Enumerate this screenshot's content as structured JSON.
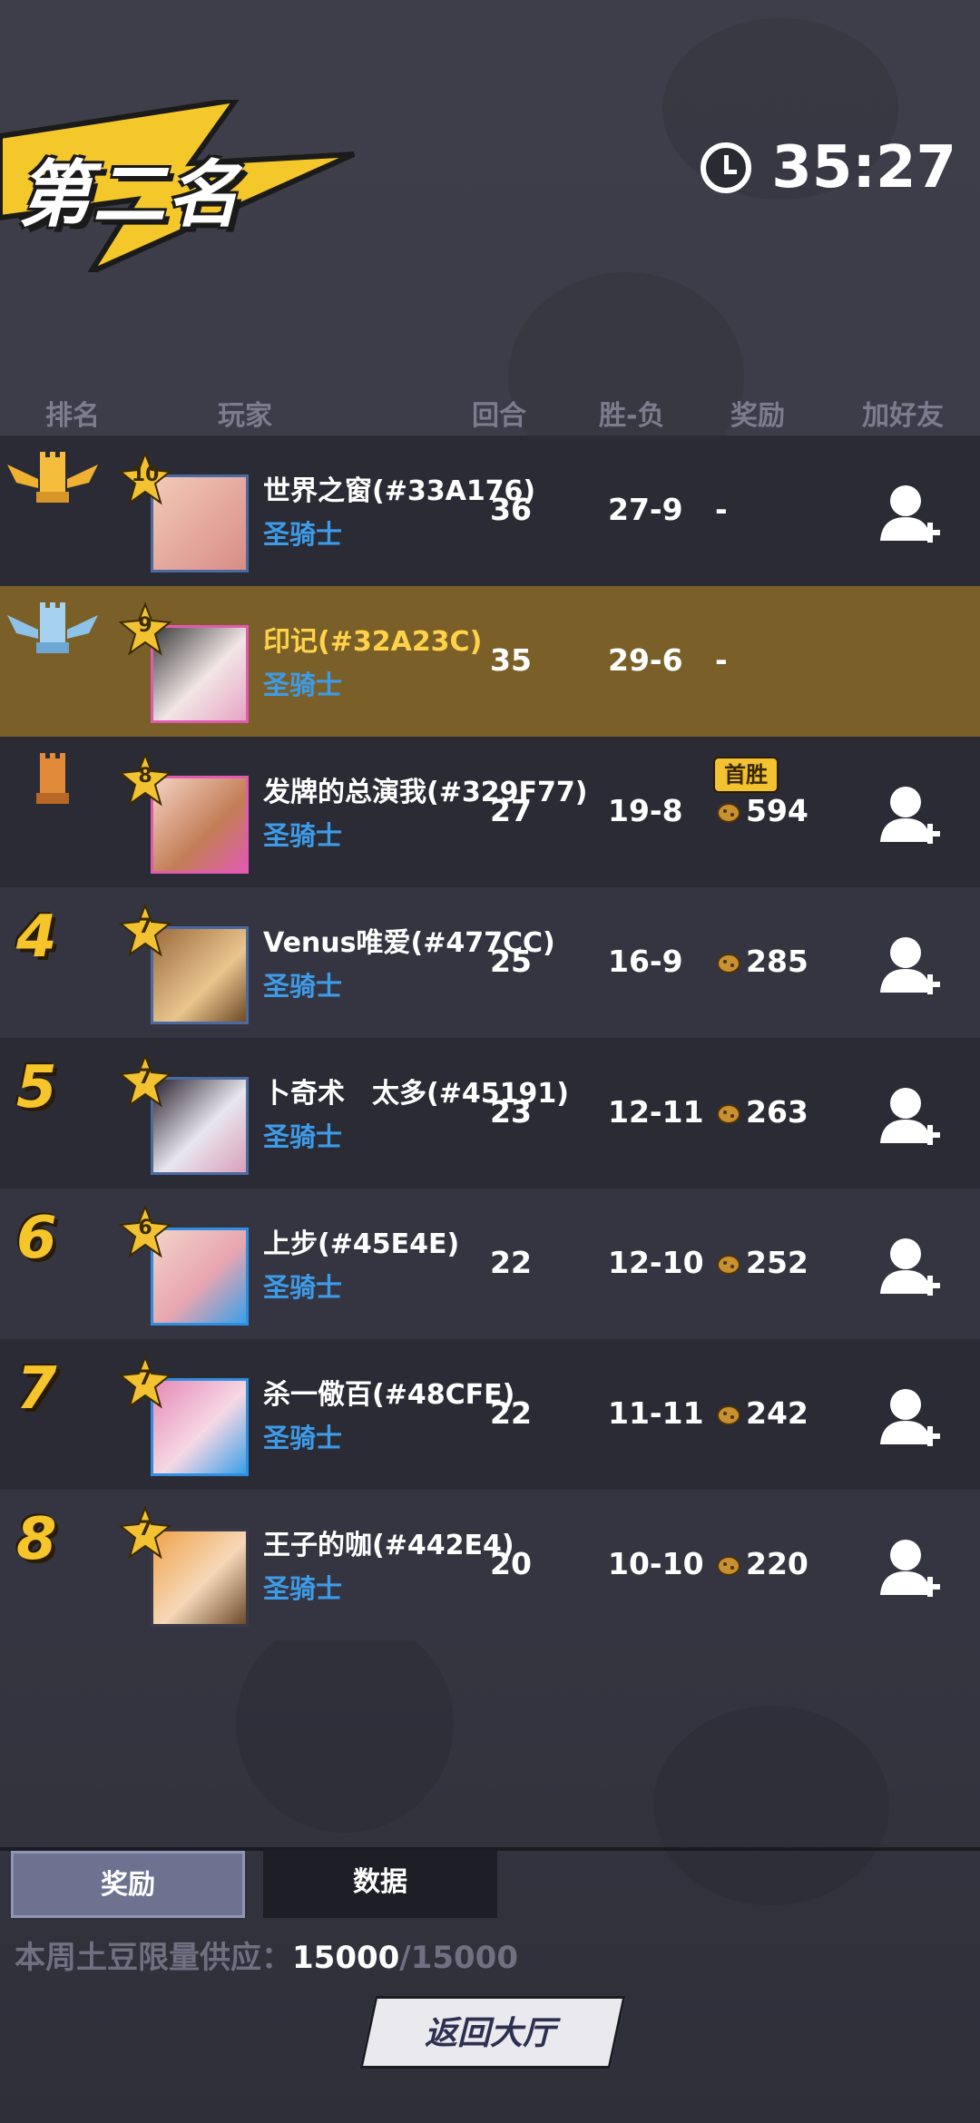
{
  "header": {
    "placement_title": "第二名",
    "timer": "35:27"
  },
  "columns": [
    "排名",
    "玩家",
    "回合",
    "胜-负",
    "奖励",
    "加好友"
  ],
  "rows": [
    {
      "rank": "1",
      "trophy": "gold-trophy-icon",
      "level": "10",
      "name": "世界之窗(#33A176)",
      "class": "圣骑士",
      "rounds": "36",
      "wl": "27-9",
      "reward": "-",
      "self": false
    },
    {
      "rank": "2",
      "trophy": "silver-trophy-icon",
      "level": "9",
      "name": "印记(#32A23C)",
      "class": "圣骑士",
      "rounds": "35",
      "wl": "29-6",
      "reward": "-",
      "self": true
    },
    {
      "rank": "3",
      "trophy": "bronze-trophy-icon",
      "level": "8",
      "name": "发牌的总演我(#329F77)",
      "class": "圣骑士",
      "rounds": "27",
      "wl": "19-8",
      "reward": "594",
      "badge": "首胜",
      "self": false
    },
    {
      "rank": "4",
      "level": "7",
      "name": "Venus唯爱(#477CC)",
      "class": "圣骑士",
      "rounds": "25",
      "wl": "16-9",
      "reward": "285",
      "self": false
    },
    {
      "rank": "5",
      "level": "7",
      "name": "卜奇术　太多(#45191)",
      "class": "圣骑士",
      "rounds": "23",
      "wl": "12-11",
      "reward": "263",
      "self": false
    },
    {
      "rank": "6",
      "level": "6",
      "name": "上步(#45E4E)",
      "class": "圣骑士",
      "rounds": "22",
      "wl": "12-10",
      "reward": "252",
      "self": false
    },
    {
      "rank": "7",
      "level": "7",
      "name": "杀一儆百(#48CFE)",
      "class": "圣骑士",
      "rounds": "22",
      "wl": "11-11",
      "reward": "242",
      "self": false
    },
    {
      "rank": "8",
      "level": "7",
      "name": "王子的咖(#442E4)",
      "class": "圣骑士",
      "rounds": "20",
      "wl": "10-10",
      "reward": "220",
      "self": false
    }
  ],
  "tabs": {
    "rewards": "奖励",
    "stats": "数据"
  },
  "supply": {
    "label": "本周土豆限量供应：",
    "current": "15000",
    "max": "/15000"
  },
  "back_button": "返回大厅",
  "colors": {
    "accent_gold": "#f6c52c",
    "class_blue": "#3d9be8",
    "self_row": "#7a6028"
  }
}
